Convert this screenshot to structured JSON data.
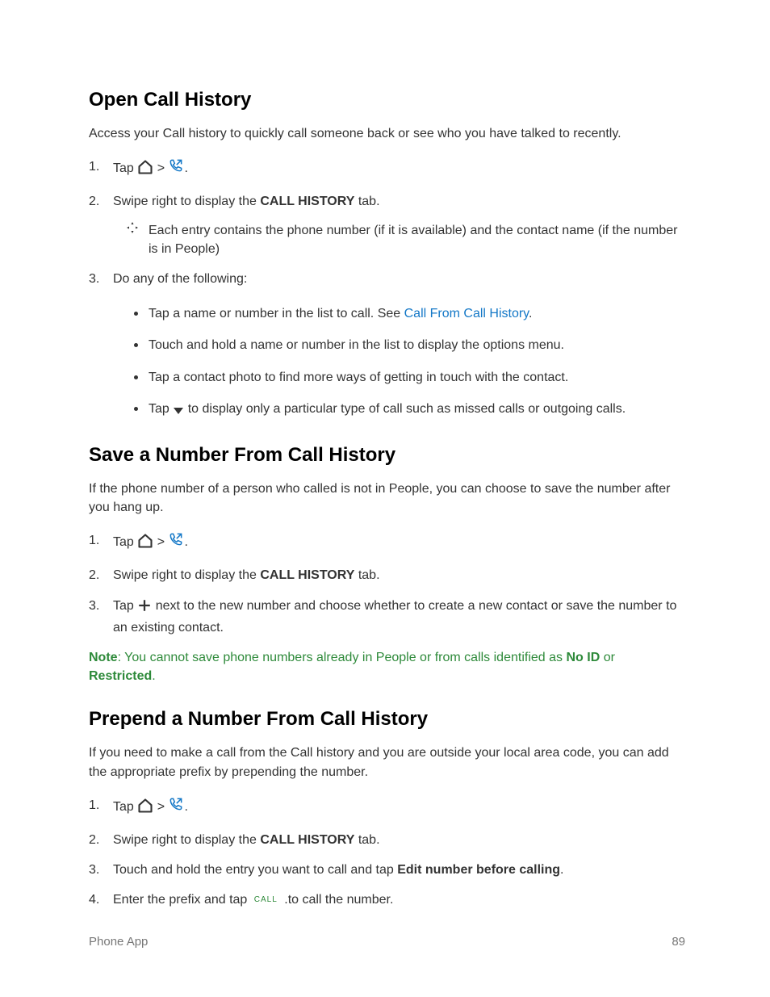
{
  "section1": {
    "heading": "Open Call History",
    "intro": "Access your Call history to quickly call someone back or see who you have talked to recently.",
    "step1_a": "Tap ",
    "step1_b": " > ",
    "step1_c": ".",
    "step2_a": "Swipe right to display the ",
    "step2_b": "CALL HISTORY",
    "step2_c": " tab.",
    "tip": "Each entry contains the phone number (if it is available) and the contact name (if the number is in People)",
    "step3": "Do any of the following:",
    "b1_a": "Tap a name or number in the list to call. See ",
    "b1_link": "Call From Call History",
    "b1_c": ".",
    "b2": "Touch and hold a name or number in the list to display the options menu.",
    "b3": "Tap a contact photo to find more ways of getting in touch with the contact.",
    "b4_a": "Tap ",
    "b4_b": " to display only a particular type of call such as missed calls or outgoing calls."
  },
  "section2": {
    "heading": "Save a Number From Call History",
    "intro": "If the phone number of a person who called is not in People, you can choose to save the number after you hang up.",
    "step1_a": "Tap ",
    "step1_b": " > ",
    "step1_c": ".",
    "step2_a": "Swipe right to display the ",
    "step2_b": "CALL HISTORY",
    "step2_c": " tab.",
    "step3_a": "Tap ",
    "step3_b": " next to the new number and choose whether to create a new contact or save the number to an existing contact.",
    "note_label": "Note",
    "note_a": ": You cannot save phone numbers already in People or from calls identified as ",
    "note_b": "No ID",
    "note_c": " or ",
    "note_d": "Restricted",
    "note_e": "."
  },
  "section3": {
    "heading": "Prepend a Number From Call History",
    "intro": "If you need to make a call from the Call history and you are outside your local area code, you can add the appropriate prefix by prepending the number.",
    "step1_a": "Tap ",
    "step1_b": " > ",
    "step1_c": ".",
    "step2_a": "Swipe right to display the ",
    "step2_b": "CALL HISTORY",
    "step2_c": " tab.",
    "step3_a": "Touch and hold the entry you want to call and tap ",
    "step3_b": "Edit number before calling",
    "step3_c": ".",
    "step4_a": "Enter the prefix and tap ",
    "step4_b": " .to call the number.",
    "call_badge": "CALL"
  },
  "footer": {
    "left": "Phone App",
    "right": "89"
  }
}
